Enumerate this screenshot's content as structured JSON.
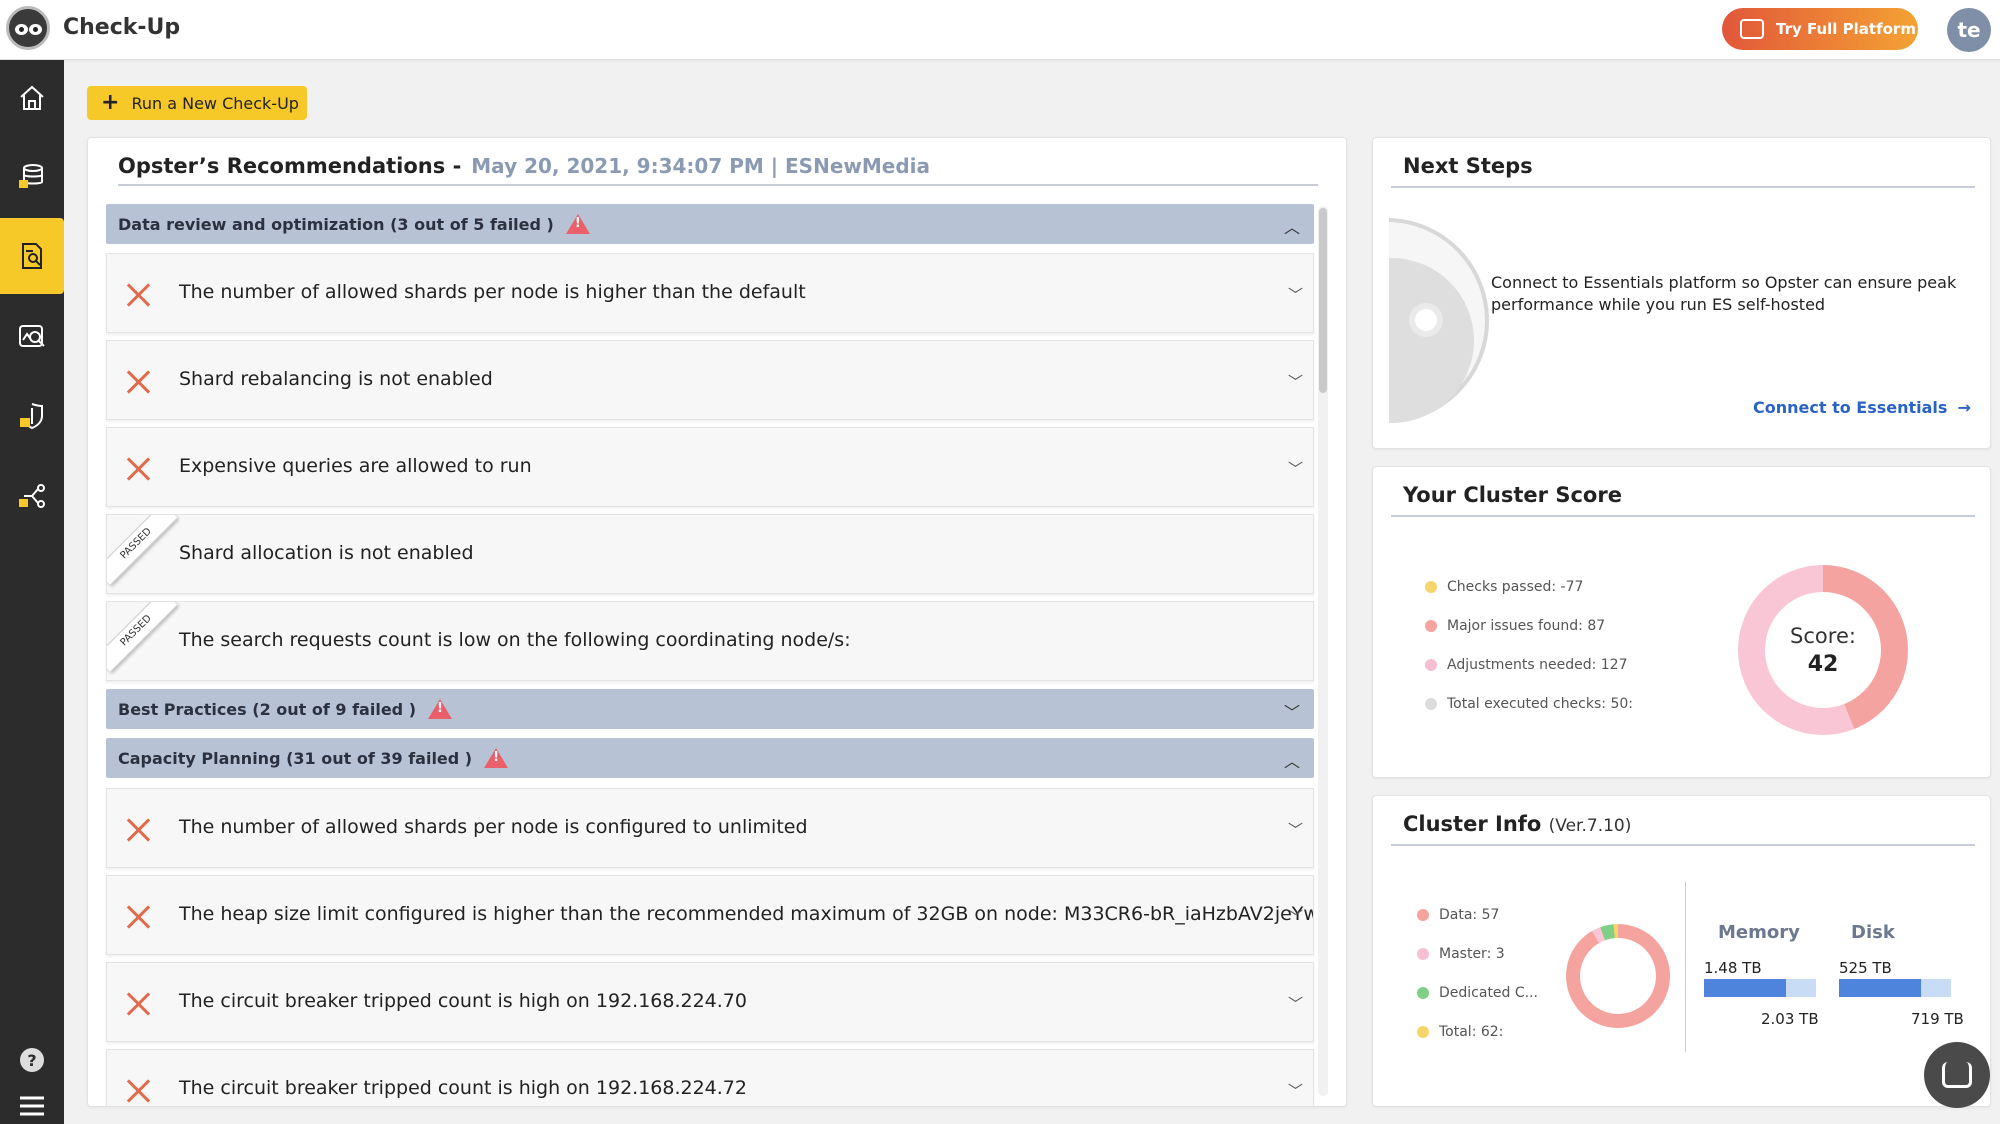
{
  "app": {
    "title": "Check-Up",
    "try_button": "Try Full Platform",
    "avatar_initials": "te"
  },
  "sidebar": {
    "items": [
      {
        "icon": "home-icon",
        "active": false
      },
      {
        "icon": "database-lock-icon",
        "active": false
      },
      {
        "icon": "report-search-icon",
        "active": true
      },
      {
        "icon": "chart-search-icon",
        "active": false
      },
      {
        "icon": "shield-lock-icon",
        "active": false
      },
      {
        "icon": "workflow-icon",
        "active": false
      }
    ],
    "bottom": [
      {
        "icon": "help-icon"
      },
      {
        "icon": "menu-icon"
      }
    ]
  },
  "run_button": {
    "plus": "+",
    "label": "Run a New Check-Up"
  },
  "recommendations": {
    "title": "Opster’s Recommendations -",
    "subtitle": "May 20, 2021, 9:34:07 PM | ESNewMedia",
    "sections": [
      {
        "title": "Data review and optimization (3 out of 5 failed )",
        "expanded": true,
        "items": [
          {
            "status": "failed",
            "text": "The number of allowed shards per node is higher than the default"
          },
          {
            "status": "failed",
            "text": "Shard rebalancing is not enabled"
          },
          {
            "status": "failed",
            "text": "Expensive queries are allowed to run"
          },
          {
            "status": "passed",
            "badge": "PASSED",
            "text": "Shard allocation is not enabled"
          },
          {
            "status": "passed",
            "badge": "PASSED",
            "text": "The search requests count is low on the following coordinating node/s:"
          }
        ]
      },
      {
        "title": "Best Practices (2 out of 9 failed )",
        "expanded": false,
        "items": []
      },
      {
        "title": "Capacity Planning (31 out of 39 failed )",
        "expanded": true,
        "items": [
          {
            "status": "failed",
            "text": "The number of allowed shards per node is configured to unlimited"
          },
          {
            "status": "failed",
            "text": "The heap size limit configured is higher than the recommended maximum of 32GB on node: M33CR6-bR_iaHzbAV2jeYw"
          },
          {
            "status": "failed",
            "text": "The circuit breaker tripped count is high on 192.168.224.70"
          },
          {
            "status": "failed",
            "text": "The circuit breaker tripped count is high on 192.168.224.72"
          }
        ]
      }
    ]
  },
  "next_steps": {
    "title": "Next Steps",
    "text": "Connect to Essentials platform so Opster can ensure peak performance while you run ES self-hosted",
    "link": "Connect to Essentials",
    "link_arrow": "→"
  },
  "cluster_score": {
    "title": "Your Cluster Score",
    "legend": [
      {
        "label": "Checks passed: -77",
        "color": "#f3d56a"
      },
      {
        "label": "Major issues found: 87",
        "color": "#f4a39e"
      },
      {
        "label": "Adjustments needed: 127",
        "color": "#f7bfd3"
      },
      {
        "label": "Total executed checks: 50:",
        "color": "#dcdcdc"
      }
    ],
    "score_label": "Score:",
    "score_value": "42",
    "score_fraction": 0.44
  },
  "cluster_info": {
    "title": "Cluster Info",
    "version": "(Ver.7.10)",
    "legend": [
      {
        "label": "Data: 57",
        "color": "#f4a39e"
      },
      {
        "label": "Master: 3",
        "color": "#f7bfd3"
      },
      {
        "label": "Dedicated C...",
        "color": "#7fcf86"
      },
      {
        "label": "Total: 62:",
        "color": "#f3d56a"
      }
    ],
    "memory": {
      "title": "Memory",
      "used": "1.48 TB",
      "total": "2.03 TB",
      "fraction": 0.73
    },
    "disk": {
      "title": "Disk",
      "used": "525 TB",
      "total": "719 TB",
      "fraction": 0.73
    }
  },
  "colors": {
    "accent": "#f7c928",
    "failed": "#e06a4c",
    "link": "#2a63c6",
    "section_bg": "#b7c3d5"
  }
}
